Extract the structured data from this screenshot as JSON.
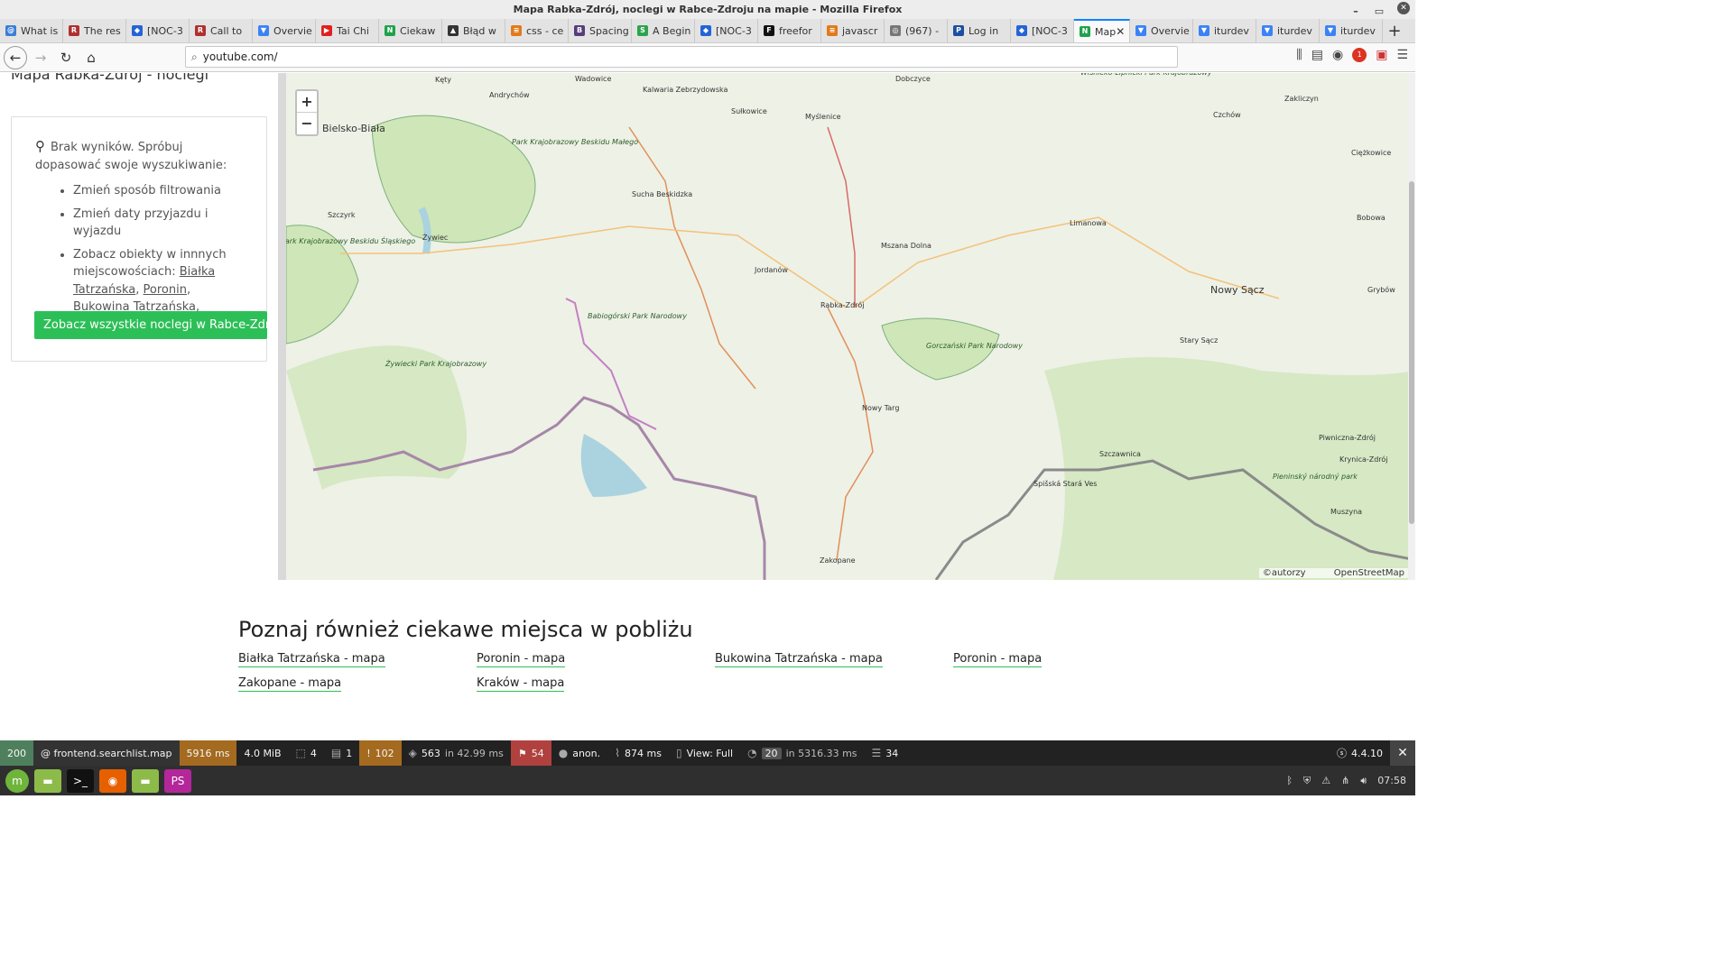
{
  "window": {
    "title": "Mapa Rabka-Zdrój, noclegi w Rabce-Zdroju na mapie - Mozilla Firefox"
  },
  "tabs": [
    {
      "label": "What is",
      "color": "#3b7dd8",
      "glyph": "@"
    },
    {
      "label": "The res",
      "color": "#b03030",
      "glyph": "R"
    },
    {
      "label": "[NOC-3",
      "color": "#2563d6",
      "glyph": "◆"
    },
    {
      "label": "Call to",
      "color": "#b03030",
      "glyph": "R"
    },
    {
      "label": "Overvie",
      "color": "#3b82f6",
      "glyph": "▼"
    },
    {
      "label": "Tai Chi",
      "color": "#e02020",
      "glyph": "▶"
    },
    {
      "label": "Ciekaw",
      "color": "#1fa24b",
      "glyph": "N"
    },
    {
      "label": "Błąd w",
      "color": "#333333",
      "glyph": "▲"
    },
    {
      "label": "css - ce",
      "color": "#e27a1b",
      "glyph": "≡"
    },
    {
      "label": "Spacing",
      "color": "#563d7c",
      "glyph": "B"
    },
    {
      "label": "A Begin",
      "color": "#2ba44e",
      "glyph": "S"
    },
    {
      "label": "[NOC-3",
      "color": "#2563d6",
      "glyph": "◆"
    },
    {
      "label": "freefor",
      "color": "#111111",
      "glyph": "F"
    },
    {
      "label": "javascr",
      "color": "#e27a1b",
      "glyph": "≡"
    },
    {
      "label": "(967) -",
      "color": "#777777",
      "glyph": "◎"
    },
    {
      "label": "Log in",
      "color": "#1b4fa0",
      "glyph": "P"
    },
    {
      "label": "[NOC-3",
      "color": "#2563d6",
      "glyph": "◆"
    },
    {
      "label": "Map",
      "color": "#1fa24b",
      "glyph": "N",
      "active": true
    },
    {
      "label": "Overvie",
      "color": "#3b82f6",
      "glyph": "▼"
    },
    {
      "label": "iturdev",
      "color": "#3b82f6",
      "glyph": "▼"
    },
    {
      "label": "iturdev",
      "color": "#3b82f6",
      "glyph": "▼"
    },
    {
      "label": "iturdev",
      "color": "#3b82f6",
      "glyph": "▼"
    }
  ],
  "nav": {
    "url": "youtube.com/",
    "adblock_count": "1"
  },
  "page": {
    "title": "Mapa Rabka-Zdrój - noclegi",
    "no_results": {
      "message": "Brak wyników. Spróbuj dopasować swoje wyszukiwanie:",
      "tips": [
        "Zmień sposób filtrowania",
        "Zmień daty przyjazdu i wyjazdu"
      ],
      "other_places_prefix": "Zobacz obiekty w innnych miejscowościach:",
      "other_places": [
        "Białka Tatrzańska",
        "Poronin",
        "Bukowina Tatrzańska"
      ],
      "button": "Zobacz wszystkie noclegi w Rabce-Zdroju"
    },
    "map": {
      "zoom_in": "+",
      "zoom_out": "−",
      "attribution_1": "©autorzy",
      "attribution_2": "OpenStreetMap",
      "labels": [
        "Wadowice",
        "Kalwaria Zebrzydowska",
        "Dobczyce",
        "Kęty",
        "Andrychów",
        "Sułkowice",
        "Myślenice",
        "Bielsko-Biała",
        "Park Krajobrazowy Beskidu Małego",
        "Wiśnicko-Lipnicki Park Krajobrazowy",
        "Zakliczyn",
        "Czchów",
        "Ciężkowice",
        "Sucha Beskidzka",
        "Szczyrk",
        "Żywiec",
        "Limanowa",
        "Bobowa",
        "Mszana Dolna",
        "Jordanów",
        "Nowy Sącz",
        "Grybów",
        "Park Krajobrazowy Beskidu Śląskiego",
        "Babiogórski Park Narodowy",
        "Rabka-Zdrój",
        "Stary Sącz",
        "Gorczański Park Narodowy",
        "Żywiecki Park Krajobrazowy",
        "Nowy Targ",
        "Piwniczna-Zdrój",
        "Krynica-Zdrój",
        "Szczawnica",
        "Spišská Stará Ves",
        "Pieninský národný park",
        "Muszyna",
        "Zakopane"
      ]
    },
    "nearby": {
      "heading": "Poznaj również ciekawe miejsca w pobliżu",
      "links": [
        "Białka Tatrzańska - mapa",
        "Poronin - mapa",
        "Bukowina Tatrzańska - mapa",
        "Poronin - mapa",
        "Zakopane - mapa",
        "Kraków - mapa"
      ]
    }
  },
  "toolbar": {
    "status": "200",
    "route": "@ frontend.searchlist.map",
    "time": "5916 ms",
    "memory": "4.0 MiB",
    "forms": "4",
    "logs": "1",
    "warnings": "102",
    "cache": "563",
    "cache_time": "in 42.99 ms",
    "translations": "54",
    "user": "anon.",
    "twig_time": "874 ms",
    "view": "View: Full",
    "queries": "20",
    "queries_time": "in 5316.33 ms",
    "db": "34",
    "version": "4.4.10"
  },
  "taskbar": {
    "clock": "07:58"
  }
}
